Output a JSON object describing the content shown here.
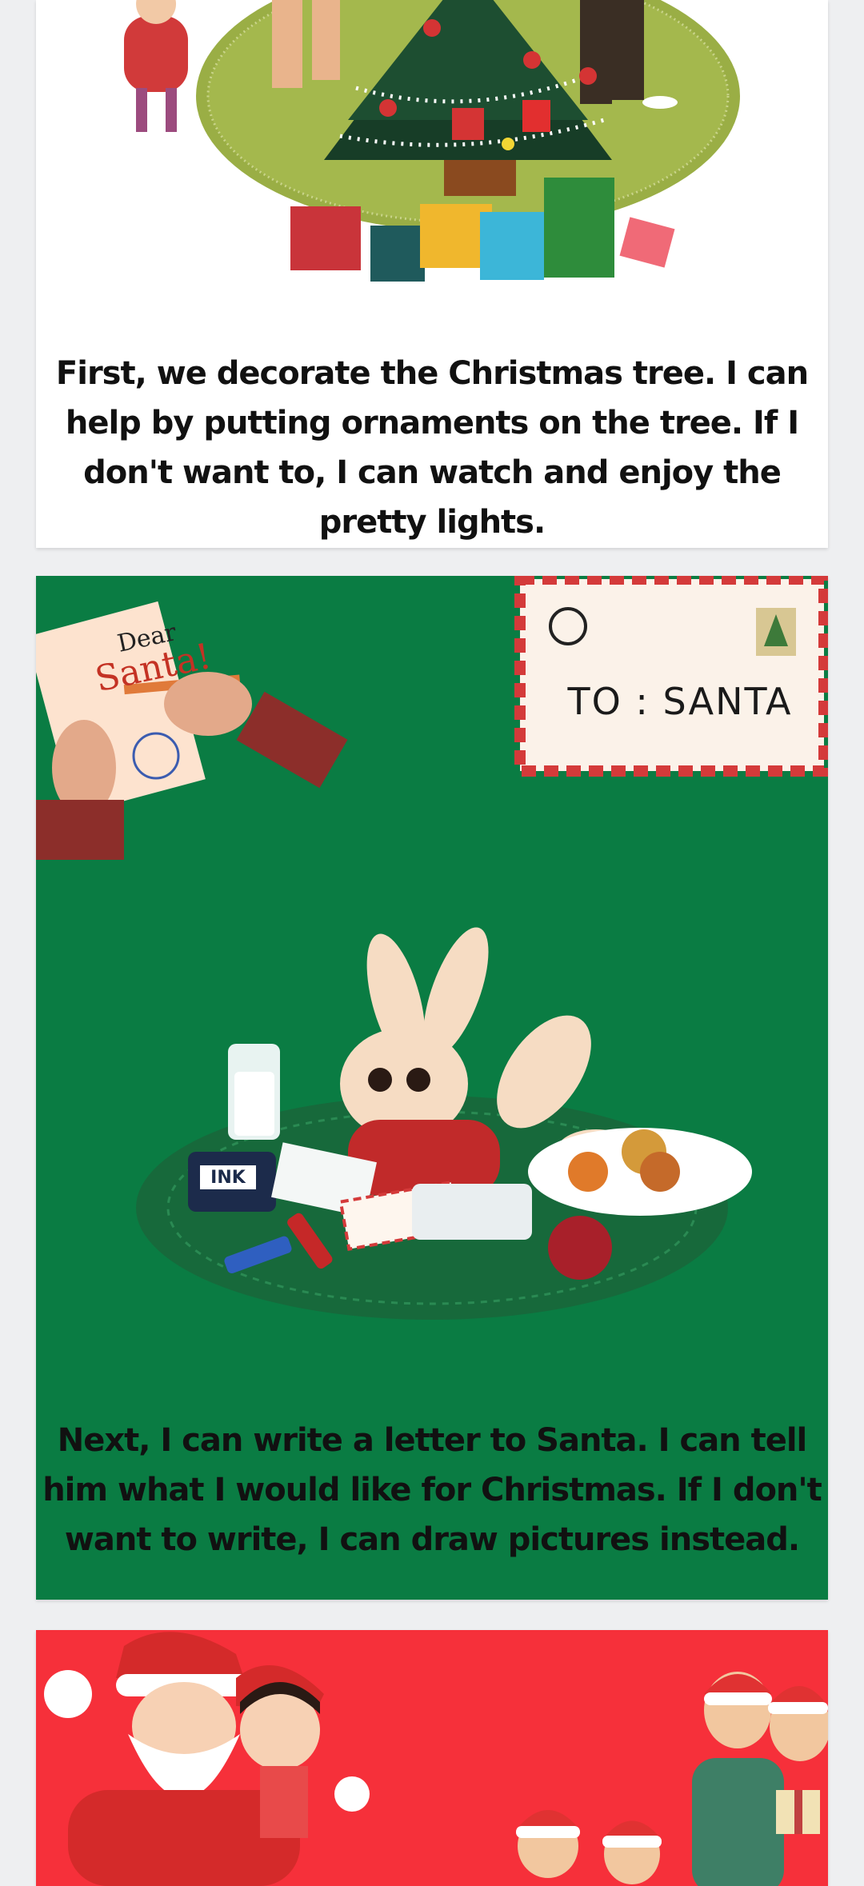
{
  "pages": [
    {
      "caption": "First, we decorate the Christmas tree. I can help by putting ornaments on the tree. If I don't want to, I can watch and enjoy the pretty lights.",
      "illustration_icon": "christmas-tree-illustration"
    },
    {
      "caption": "Next, I can write a letter to Santa. I can tell him what I would like for Christmas. If I don't want to write, I can draw pictures instead.",
      "envelope_text": "TO : SANTA",
      "letter_salutation": "Dear",
      "letter_name": "Santa!",
      "ink_label": "INK",
      "illustration_icon": "bunny-letter-illustration"
    },
    {
      "caption": "",
      "illustration_icon": "santa-family-illustration"
    }
  ],
  "colors": {
    "background": "#eeeff1",
    "page1_bg": "#ffffff",
    "page2_bg": "#0a7c43",
    "page3_bg": "#f6303a"
  }
}
